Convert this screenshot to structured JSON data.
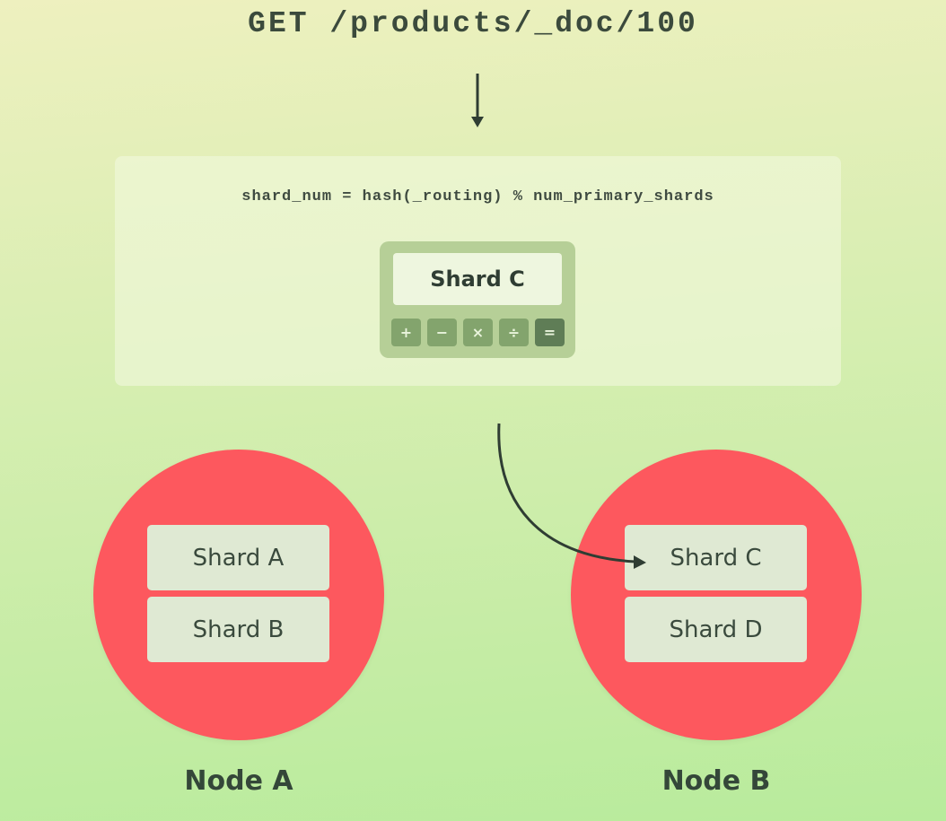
{
  "request": {
    "text": "GET /products/_doc/100"
  },
  "formula": {
    "text": "shard_num = hash(_routing) % num_primary_shards"
  },
  "calculator": {
    "display": "Shard C",
    "keys": [
      "+",
      "−",
      "×",
      "÷",
      "="
    ]
  },
  "nodes": [
    {
      "label": "Node A",
      "shards": [
        "Shard A",
        "Shard B"
      ]
    },
    {
      "label": "Node B",
      "shards": [
        "Shard C",
        "Shard D"
      ]
    }
  ],
  "colors": {
    "node": "#fd585e",
    "shard": "#dfe9d3",
    "text": "#344739",
    "arrow": "#2f3d33"
  }
}
